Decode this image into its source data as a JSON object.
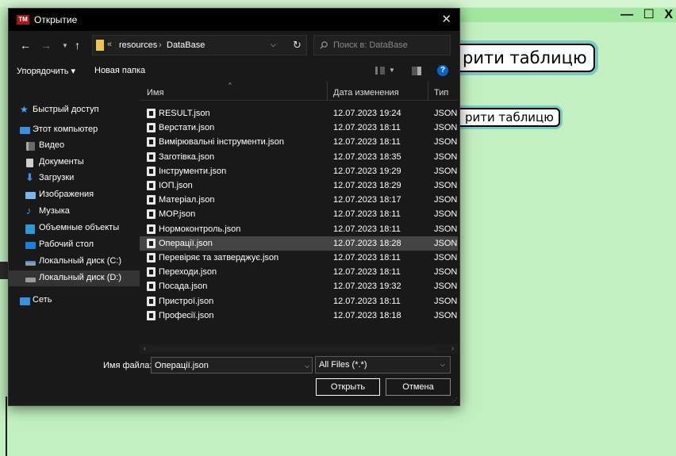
{
  "background_app": {
    "window_controls": [
      "—",
      "☐",
      "X"
    ],
    "button1_label": "рити таблицю",
    "button2_label": "рити таблицю"
  },
  "dialog": {
    "title": "Открытие",
    "app_icon_text": "TM",
    "address": {
      "overflow_chevron": "«",
      "crumbs": [
        "resources",
        "DataBase"
      ],
      "separator": "›"
    },
    "search_placeholder": "Поиск в: DataBase",
    "toolbar": {
      "organize_label": "Упорядочить ▾",
      "new_folder_label": "Новая папка"
    },
    "nav_pane": [
      {
        "label": "Быстрый доступ",
        "icon": "star-icon"
      },
      {
        "label": "Этот компьютер",
        "icon": "computer-icon"
      },
      {
        "label": "Видео",
        "icon": "video-icon"
      },
      {
        "label": "Документы",
        "icon": "documents-icon"
      },
      {
        "label": "Загрузки",
        "icon": "downloads-icon"
      },
      {
        "label": "Изображения",
        "icon": "images-icon"
      },
      {
        "label": "Музыка",
        "icon": "music-icon"
      },
      {
        "label": "Объемные объекты",
        "icon": "3d-objects-icon"
      },
      {
        "label": "Рабочий стол",
        "icon": "desktop-icon"
      },
      {
        "label": "Локальный диск (C:)",
        "icon": "drive-c-icon"
      },
      {
        "label": "Локальный диск (D:)",
        "icon": "drive-d-icon"
      },
      {
        "label": "Сеть",
        "icon": "network-icon"
      }
    ],
    "columns": {
      "name": "Имя",
      "date": "Дата изменения",
      "type": "Тип"
    },
    "files": [
      {
        "name": "RESULT.json",
        "date": "12.07.2023 19:24",
        "type": "JSON File"
      },
      {
        "name": "Верстати.json",
        "date": "12.07.2023 18:11",
        "type": "JSON File"
      },
      {
        "name": "Вимірювальні інструменти.json",
        "date": "12.07.2023 18:11",
        "type": "JSON File"
      },
      {
        "name": "Заготівка.json",
        "date": "12.07.2023 18:35",
        "type": "JSON File"
      },
      {
        "name": "Інструменти.json",
        "date": "12.07.2023 19:29",
        "type": "JSON File"
      },
      {
        "name": "ІОП.json",
        "date": "12.07.2023 18:29",
        "type": "JSON File"
      },
      {
        "name": "Матеріал.json",
        "date": "12.07.2023 18:17",
        "type": "JSON File"
      },
      {
        "name": "МОР.json",
        "date": "12.07.2023 18:11",
        "type": "JSON File"
      },
      {
        "name": "Нормоконтроль.json",
        "date": "12.07.2023 18:11",
        "type": "JSON File"
      },
      {
        "name": "Операції.json",
        "date": "12.07.2023 18:28",
        "type": "JSON File"
      },
      {
        "name": "Перевіряє та затверджує.json",
        "date": "12.07.2023 18:11",
        "type": "JSON File"
      },
      {
        "name": "Переходи.json",
        "date": "12.07.2023 18:11",
        "type": "JSON File"
      },
      {
        "name": "Посада.json",
        "date": "12.07.2023 19:32",
        "type": "JSON File"
      },
      {
        "name": "Пристрої.json",
        "date": "12.07.2023 18:11",
        "type": "JSON File"
      },
      {
        "name": "Професії.json",
        "date": "12.07.2023 18:18",
        "type": "JSON File"
      }
    ],
    "selected_file": "Операції.json",
    "filename_label": "Имя файла:",
    "filename_value": "Операції.json",
    "filetype_value": "All Files (*.*)",
    "open_button": "Открыть",
    "cancel_button": "Отмена"
  }
}
